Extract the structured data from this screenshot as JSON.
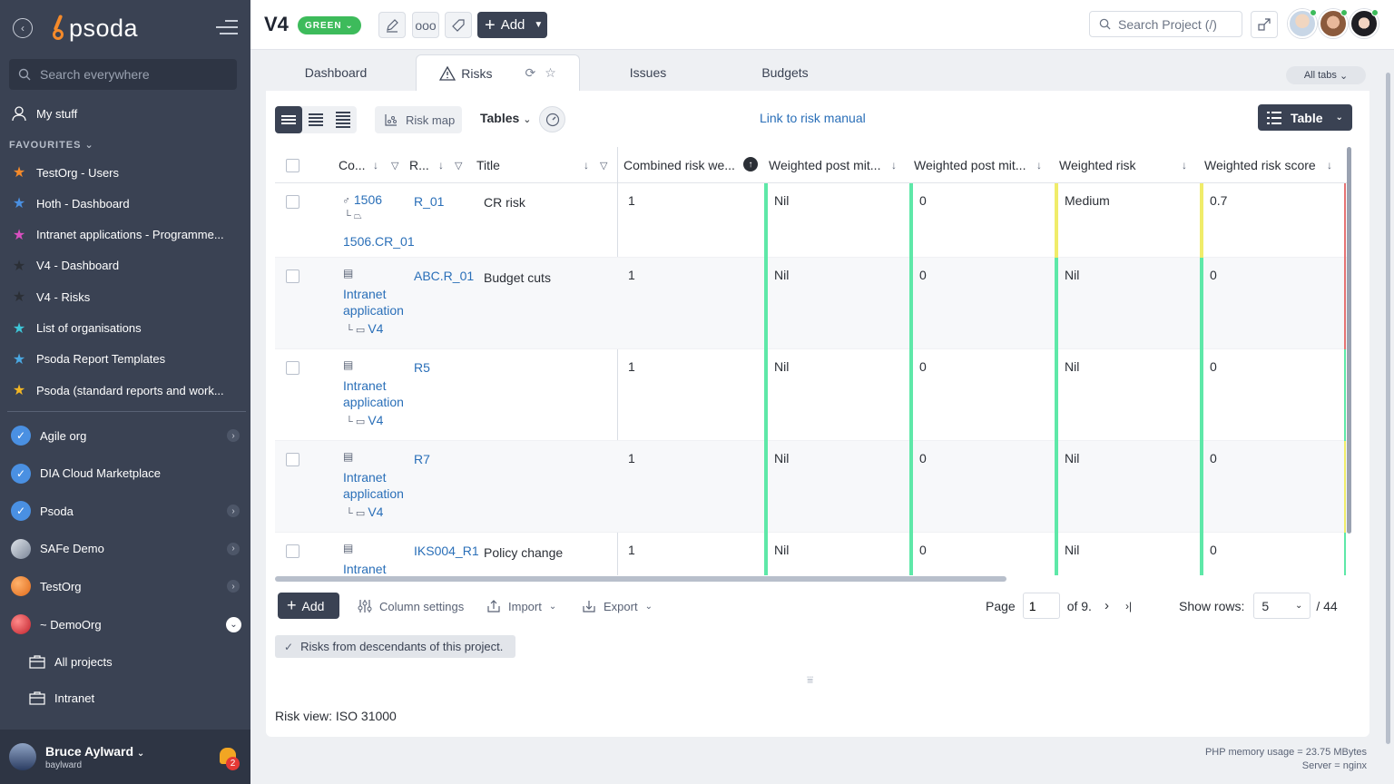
{
  "sidebar": {
    "logo_text": "psoda",
    "search_placeholder": "Search everywhere",
    "my_stuff": "My stuff",
    "favourites_label": "FAVOURITES",
    "favourites": [
      {
        "label": "TestOrg - Users",
        "color": "#f58a2a"
      },
      {
        "label": "Hoth - Dashboard",
        "color": "#4a90e2"
      },
      {
        "label": "Intranet applications - Programme...",
        "color": "#d94fc0"
      },
      {
        "label": "V4 - Dashboard",
        "color": "#2b2f36"
      },
      {
        "label": "V4 - Risks",
        "color": "#2b2f36"
      },
      {
        "label": "List of organisations",
        "color": "#3ec6d8"
      },
      {
        "label": "Psoda Report Templates",
        "color": "#4aa8e2"
      },
      {
        "label": "Psoda (standard reports and work...",
        "color": "#f2b624"
      }
    ],
    "orgs": [
      {
        "label": "Agile org"
      },
      {
        "label": "DIA Cloud Marketplace"
      },
      {
        "label": "Psoda"
      },
      {
        "label": "SAFe Demo"
      },
      {
        "label": "TestOrg"
      },
      {
        "label": "~ DemoOrg"
      }
    ],
    "sub_items": [
      {
        "label": "All projects"
      },
      {
        "label": "Intranet"
      }
    ],
    "user": {
      "name": "Bruce Aylward",
      "username": "baylward",
      "notifications": "2"
    }
  },
  "header": {
    "title": "V4",
    "status": "GREEN",
    "add_label": "Add",
    "search_placeholder": "Search Project (/)"
  },
  "tabs": {
    "items": [
      "Dashboard",
      "Risks",
      "Issues",
      "Budgets"
    ],
    "all_tabs": "All tabs"
  },
  "toolbar": {
    "risk_map": "Risk map",
    "tables": "Tables",
    "link_manual": "Link to risk manual",
    "table_view": "Table"
  },
  "table": {
    "headers": {
      "code": "Co...",
      "ref": "R...",
      "title": "Title",
      "combined": "Combined risk we...",
      "wpm1": "Weighted post mit...",
      "wpm2": "Weighted post mit...",
      "weighted_risk": "Weighted risk",
      "weighted_score": "Weighted risk score"
    },
    "rows": [
      {
        "code_a": "1506",
        "code_b": "1506.CR_01",
        "ref": "R_01",
        "title": "CR risk",
        "combined": "1",
        "wpm1": "Nil",
        "wpm2": "0",
        "weighted_risk": "Medium",
        "score": "0.7"
      },
      {
        "code_a": "Intranet",
        "code_b": "application",
        "code_c": "V4",
        "ref": "ABC.R_01",
        "title": "Budget cuts",
        "combined": "1",
        "wpm1": "Nil",
        "wpm2": "0",
        "weighted_risk": "Nil",
        "score": "0"
      },
      {
        "code_a": "Intranet",
        "code_b": "application",
        "code_c": "V4",
        "ref": "R5",
        "title": "",
        "combined": "1",
        "wpm1": "Nil",
        "wpm2": "0",
        "weighted_risk": "Nil",
        "score": "0"
      },
      {
        "code_a": "Intranet",
        "code_b": "application",
        "code_c": "V4",
        "ref": "R7",
        "title": "",
        "combined": "1",
        "wpm1": "Nil",
        "wpm2": "0",
        "weighted_risk": "Nil",
        "score": "0"
      },
      {
        "code_a": "Intranet",
        "ref": "IKS004_R1",
        "title": "Policy change",
        "combined": "1",
        "wpm1": "Nil",
        "wpm2": "0",
        "weighted_risk": "Nil",
        "score": "0"
      }
    ]
  },
  "footer": {
    "add": "Add",
    "column_settings": "Column settings",
    "import": "Import",
    "export": "Export",
    "page_label": "Page",
    "page_value": "1",
    "of_pages": "of 9.",
    "show_rows": "Show rows:",
    "rows_value": "5",
    "total": "/ 44",
    "descendants": "Risks from descendants of this project.",
    "risk_view": "Risk view: ISO 31000"
  },
  "server": {
    "memory": "PHP memory usage = 23.75 MBytes",
    "server": "Server = nginx"
  },
  "colors": {
    "sidebar_bg": "#3a4253",
    "accent_green": "#5ee8a8",
    "accent_yellow": "#f0ec6a",
    "link": "#2a6fb8"
  }
}
